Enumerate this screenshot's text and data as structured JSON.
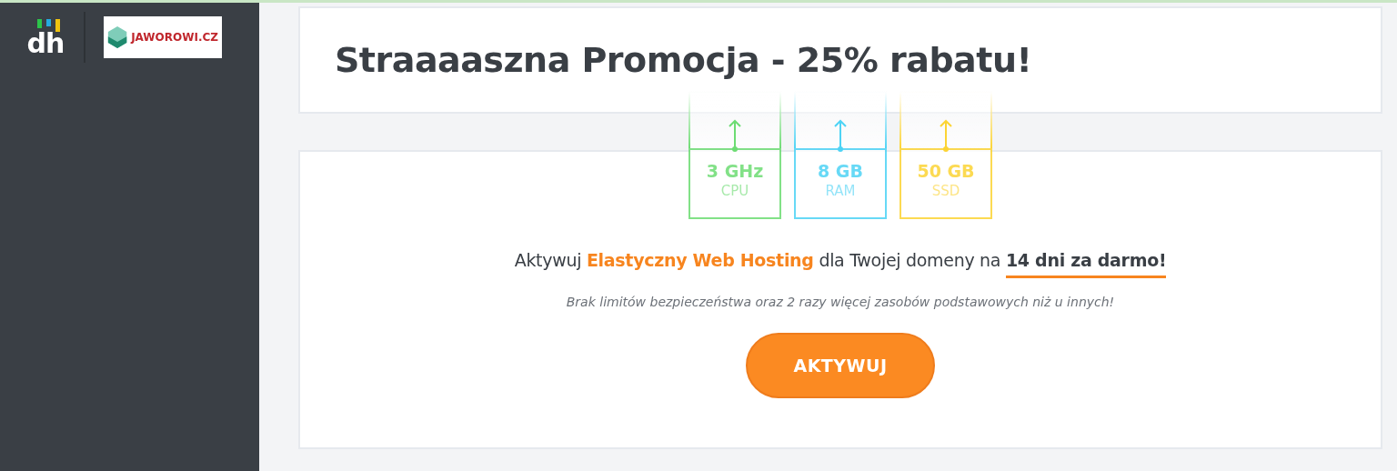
{
  "sidebar": {
    "logo_text": "dh",
    "partner_logo_text": "JAWOROWI.CZ"
  },
  "promo": {
    "title": "Straaaaszna Promocja - 25% rabatu!"
  },
  "specs": [
    {
      "value": "3 GHz",
      "label": "CPU",
      "color": "#6ddc73"
    },
    {
      "value": "8 GB",
      "label": "RAM",
      "color": "#4dd3f5"
    },
    {
      "value": "50 GB",
      "label": "SSD",
      "color": "#fcd434"
    }
  ],
  "offer": {
    "headline": [
      {
        "kind": "plain",
        "text": "Aktywuj "
      },
      {
        "kind": "accent",
        "text": "Elastyczny Web Hosting"
      },
      {
        "kind": "plain",
        "text": " dla Twojej domeny na "
      },
      {
        "kind": "emphasis",
        "text": "14 dni za darmo!"
      }
    ],
    "subtext": "Brak limitów bezpieczeństwa oraz 2 razy więcej zasobów podstawowych niż u innych!",
    "button": "AKTYWUJ"
  }
}
